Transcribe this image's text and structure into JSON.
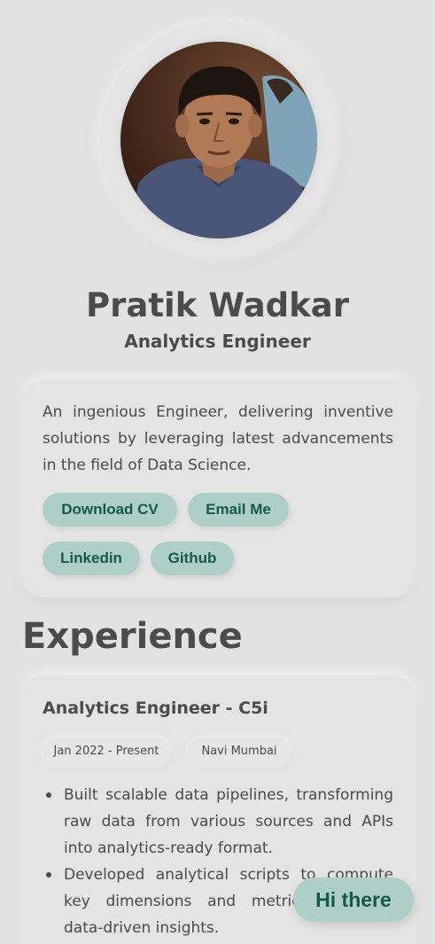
{
  "profile": {
    "name": "Pratik Wadkar",
    "role": "Analytics Engineer",
    "bio": "An ingenious Engineer, delivering inventive solutions by leveraging latest advancements in the field of Data Science."
  },
  "actions": {
    "download_cv": "Download CV",
    "email_me": "Email Me",
    "linkedin": "Linkedin",
    "github": "Github"
  },
  "experience": {
    "heading": "Experience",
    "jobs": [
      {
        "title": "Analytics Engineer - C5i",
        "period": "Jan 2022 - Present",
        "location": "Navi Mumbai",
        "bullets": [
          "Built scalable data pipelines, transforming raw data from various sources and APIs into analytics-ready format.",
          "Developed analytical scripts to compute key dimensions and metrics, enabling data-driven insights."
        ]
      }
    ]
  },
  "chat": {
    "label": "Hi there"
  },
  "colors": {
    "background": "#e2e2e2",
    "accent": "#aecfc8",
    "accent_text": "#135a48",
    "text": "#4a4a4a"
  }
}
